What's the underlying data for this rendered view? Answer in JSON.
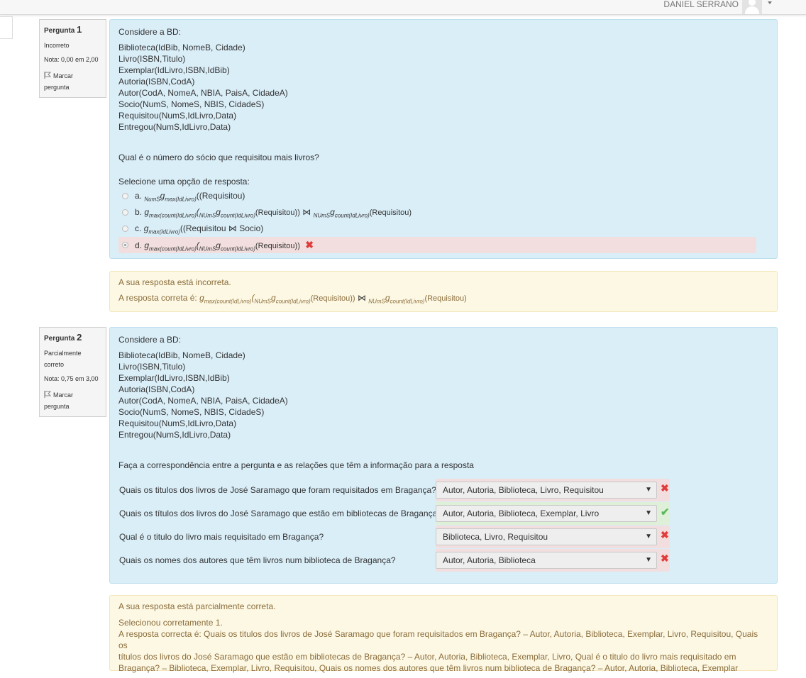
{
  "header": {
    "username": "DANIEL SERRANO"
  },
  "q1": {
    "info": {
      "label": "Pergunta",
      "number": "1",
      "state": "Incorreto",
      "grade": "Nota: 0,00 em 2,00",
      "flag1": "Marcar",
      "flag2": "pergunta"
    },
    "schema": [
      "Considere a BD:",
      "Biblioteca(IdBib, NomeB, Cidade)",
      "Livro(ISBN,Titulo)",
      "Exemplar(IdLivro,ISBN,IdBib)",
      "Autoria(ISBN,CodA)",
      "Autor(CodA, NomeA, NBIA, PaisA, CidadeA)",
      "Socio(NumS, NomeS, NBIS, CidadeS)",
      "Requisitou(NumS,IdLivro,Data)",
      "Entregou(NumS,IdLivro,Data)"
    ],
    "question": "Qual é o número do sócio que requisitou mais livros?",
    "prompt": "Selecione uma opção de resposta:",
    "options": [
      {
        "letter": "a.",
        "parts": [
          "NumS",
          "g",
          "max(IdLivro)",
          "((Requisitou)"
        ]
      },
      {
        "letter": "b.",
        "parts": [
          "g",
          "max(count(IdLivro)",
          "(",
          "NUmS",
          "g",
          "count(IdLivro)",
          "(Requisitou))",
          "⋈",
          "NUmS",
          "g",
          "count(IdLivro)",
          "(Requisitou)"
        ]
      },
      {
        "letter": "c.",
        "parts": [
          "g",
          "max(IdLivro)",
          "((Requisitou",
          "⋈",
          "Socio)"
        ]
      },
      {
        "letter": "d.",
        "parts": [
          "g",
          "max(count(IdLivro)",
          "(",
          "NUmS",
          "g",
          "count(IdLivro)",
          "(Requisitou))"
        ]
      }
    ],
    "feedback": {
      "line1": "A sua resposta está incorreta.",
      "prefix": "A resposta correta é:",
      "parts": [
        "g",
        "max(count(IdLivro)",
        "(",
        "NUmS",
        "g",
        "count(IdLivro)",
        "(Requisitou))",
        "⋈",
        "NUmS",
        "g",
        "count(IdLivro)",
        "(Requisitou)"
      ]
    }
  },
  "q2": {
    "info": {
      "label": "Pergunta",
      "number": "2",
      "state1": "Parcialmente",
      "state2": "correto",
      "grade": "Nota: 0,75 em 3,00",
      "flag1": "Marcar",
      "flag2": "pergunta"
    },
    "schema": [
      "Considere a BD:",
      "Biblioteca(IdBib, NomeB, Cidade)",
      "Livro(ISBN,Titulo)",
      "Exemplar(IdLivro,ISBN,IdBib)",
      "Autoria(ISBN,CodA)",
      "Autor(CodA, NomeA, NBIA, PaisA, CidadeA)",
      "Socio(NumS, NomeS, NBIS, CidadeS)",
      "Requisitou(NumS,IdLivro,Data)",
      "Entregou(NumS,IdLivro,Data)"
    ],
    "instruction": "Faça a correspondência entre a pergunta e as relações que têm a informação para a resposta",
    "rows": [
      {
        "question": "Quais os titulos dos livros de José Saramago que foram requisitados em Bragança?",
        "answer": "Autor, Autoria, Biblioteca, Livro, Requisitou",
        "status": "incorrect"
      },
      {
        "question": "Quais os títulos dos livros do José Saramago que estão em bibliotecas de Bragança?",
        "answer": "Autor, Autoria, Biblioteca, Exemplar, Livro",
        "status": "correct"
      },
      {
        "question": "Qual é o titulo do livro mais requisitado em Bragança?",
        "answer": "Biblioteca, Livro, Requisitou",
        "status": "incorrect"
      },
      {
        "question": "Quais os nomes dos autores que têm livros num biblioteca de Bragança?",
        "answer": "Autor, Autoria, Biblioteca",
        "status": "incorrect"
      }
    ],
    "feedback": {
      "line1": "A sua resposta está parcialmente correta.",
      "line2": "Selecionou corretamente 1.",
      "line3": "A resposta correcta é: Quais os titulos dos livros de José Saramago que foram requisitados em Bragança? – Autor, Autoria, Biblioteca, Exemplar, Livro, Requisitou, Quais os",
      "line4": "títulos dos livros do José Saramago que estão em bibliotecas de Bragança? – Autor, Autoria, Biblioteca, Exemplar, Livro, Qual é o titulo do livro mais requisitado em",
      "line5": "Bragança? – Biblioteca, Exemplar, Livro, Requisitou, Quais os nomes dos autores que têm livros num biblioteca de Bragança? – Autor, Autoria, Biblioteca, Exemplar"
    }
  },
  "icons": {
    "wrong": "✖",
    "right": "✔",
    "arrow": "▼"
  },
  "colors": {
    "question_bg": "#daeef8",
    "feedback_bg": "#fdf8e4",
    "incorrect_bg": "#f2dede",
    "correct_bg": "#dff0d8",
    "wrong_icon": "#e03c3c",
    "right_icon": "#5cb85c"
  }
}
